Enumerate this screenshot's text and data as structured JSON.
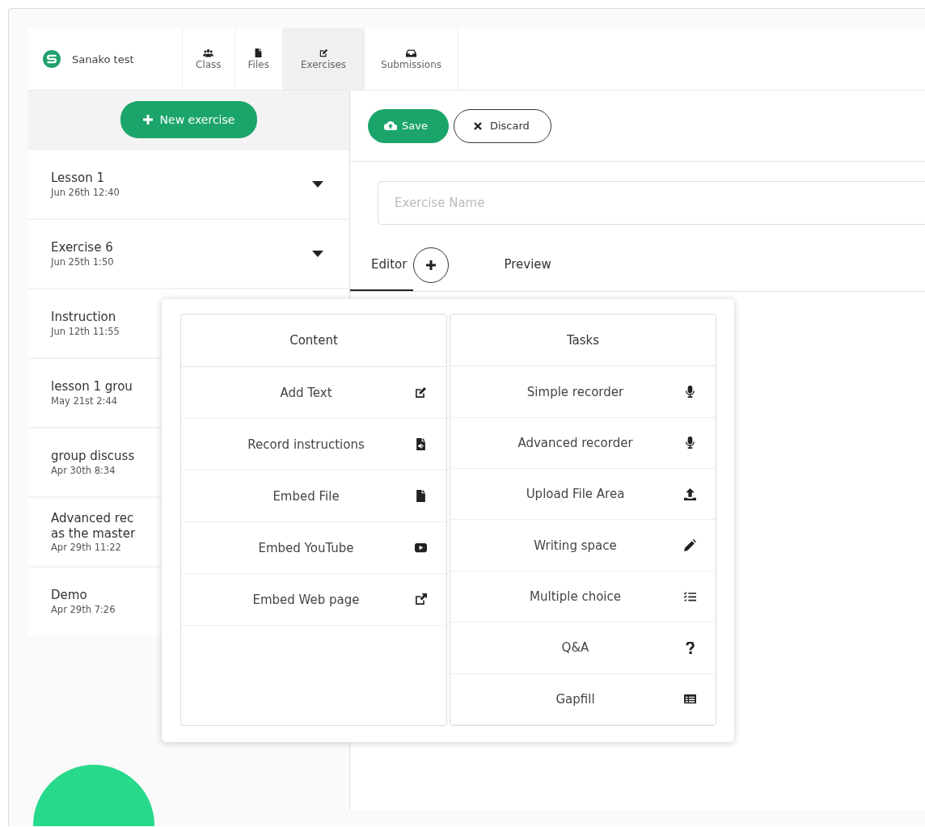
{
  "brand": {
    "name": "Sanako test"
  },
  "nav_tabs": [
    {
      "label": "Class",
      "kind": "users",
      "selected": false
    },
    {
      "label": "Files",
      "kind": "file",
      "selected": false
    },
    {
      "label": "Exercises",
      "kind": "edit",
      "selected": true
    },
    {
      "label": "Submissions",
      "kind": "inbox",
      "selected": false
    }
  ],
  "sidebar": {
    "new_button": "New exercise",
    "items": [
      {
        "title_lines": [
          "Lesson 1"
        ],
        "date": "Jun 26th 12:40",
        "has_menu": true
      },
      {
        "title_lines": [
          "Exercise 6"
        ],
        "date": "Jun 25th 1:50",
        "has_menu": true
      },
      {
        "title_lines": [
          "Instruction"
        ],
        "date": "Jun 12th 11:55",
        "has_menu": false
      },
      {
        "title_lines": [
          "lesson 1 grou"
        ],
        "date": "May 21st 2:44",
        "has_menu": false
      },
      {
        "title_lines": [
          "group discuss"
        ],
        "date": "Apr 30th 8:34",
        "has_menu": false
      },
      {
        "title_lines": [
          "Advanced rec",
          "as the master"
        ],
        "date": "Apr 29th 11:22",
        "has_menu": false
      },
      {
        "title_lines": [
          "Demo"
        ],
        "date": "Apr 29th 7:26",
        "has_menu": false
      }
    ]
  },
  "toolbar": {
    "save": "Save",
    "discard": "Discard"
  },
  "exercise_name": {
    "placeholder": "Exercise Name"
  },
  "editor_tabs": [
    {
      "label": "Editor",
      "selected": true
    },
    {
      "label": "Preview",
      "selected": false
    }
  ],
  "add_menu": {
    "columns": [
      {
        "title": "Content",
        "items": [
          {
            "label": "Add Text",
            "kind": "edit"
          },
          {
            "label": "Record instructions",
            "kind": "file-audio"
          },
          {
            "label": "Embed File",
            "kind": "file"
          },
          {
            "label": "Embed YouTube",
            "kind": "video"
          },
          {
            "label": "Embed Web page",
            "kind": "external"
          }
        ]
      },
      {
        "title": "Tasks",
        "items": [
          {
            "label": "Simple recorder",
            "kind": "mic"
          },
          {
            "label": "Advanced recorder",
            "kind": "mic"
          },
          {
            "label": "Upload File Area",
            "kind": "upload"
          },
          {
            "label": "Writing space",
            "kind": "pencil"
          },
          {
            "label": "Multiple choice",
            "kind": "list"
          },
          {
            "label": "Q&A",
            "kind": "question"
          },
          {
            "label": "Gapfill",
            "kind": "table"
          }
        ]
      }
    ]
  }
}
